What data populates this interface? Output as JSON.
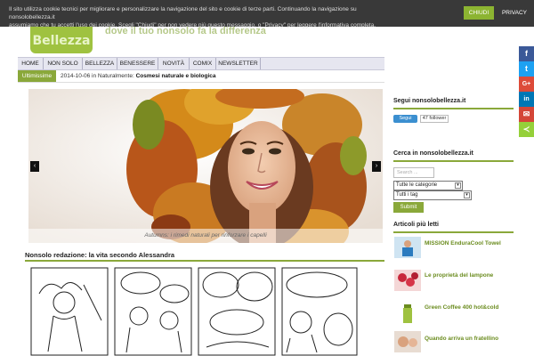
{
  "cookie": {
    "text_line1": "Il sito utilizza cookie tecnici per migliorare e personalizzare la navigazione del sito e cookie di terze parti. Continuando la navigazione su nonsolobellezza.it",
    "text_line2": "assumiamo che tu accetti l'uso dei cookie. Scegli \"Chiudi\" per non vedere più questo messaggio, o \"Privacy\" per leggere l'informativa completa.",
    "close_label": "CHIUDI",
    "privacy_label": "PRIVACY"
  },
  "header": {
    "logo_text": "Bellezza",
    "tagline": "dove il tuo nonsolo fa la differenza"
  },
  "nav": {
    "items": [
      "HOME",
      "NON SOLO",
      "BELLEZZA",
      "BENESSERE",
      "NOVITÀ",
      "COMIX",
      "NEWSLETTER"
    ]
  },
  "ticker": {
    "label": "Ultimissime",
    "date_text": "2014-10-06 in Naturalmente:",
    "headline": "Cosmesi naturale e biologica"
  },
  "slider": {
    "caption": "Autumns: i rimedi naturali per rinforzare i capelli",
    "prev_symbol": "‹",
    "next_symbol": "›"
  },
  "redazione": {
    "title": "Nonsolo redazione: la vita secondo Alessandra"
  },
  "sidebar": {
    "follow_title": "Segui nonsolobellezza.it",
    "follow_button": "Segui",
    "follower_count": "47 follower",
    "search_title": "Cerca in nonsolobellezza.it",
    "search_placeholder": "Search ...",
    "categories_select": "Tutte le categorie",
    "tags_select": "Tutti i tag",
    "submit_label": "Submit",
    "popular_title": "Articoli più letti",
    "articles": [
      "MISSION EnduraCool Towel",
      "Le proprietà del lampone",
      "Green Coffee 400 hot&cold",
      "Quando arriva un fratellino"
    ]
  },
  "share": {
    "items": [
      "f",
      "t",
      "G+",
      "in",
      "✉",
      "≺"
    ]
  },
  "colors": {
    "accent_green": "#8aa83a",
    "cookie_close": "#8cb431",
    "facebook": "#3b5998",
    "twitter": "#1da1f2",
    "google": "#dd4b39",
    "linkedin": "#0077b5",
    "gmail": "#d44638",
    "share": "#95d03a"
  }
}
